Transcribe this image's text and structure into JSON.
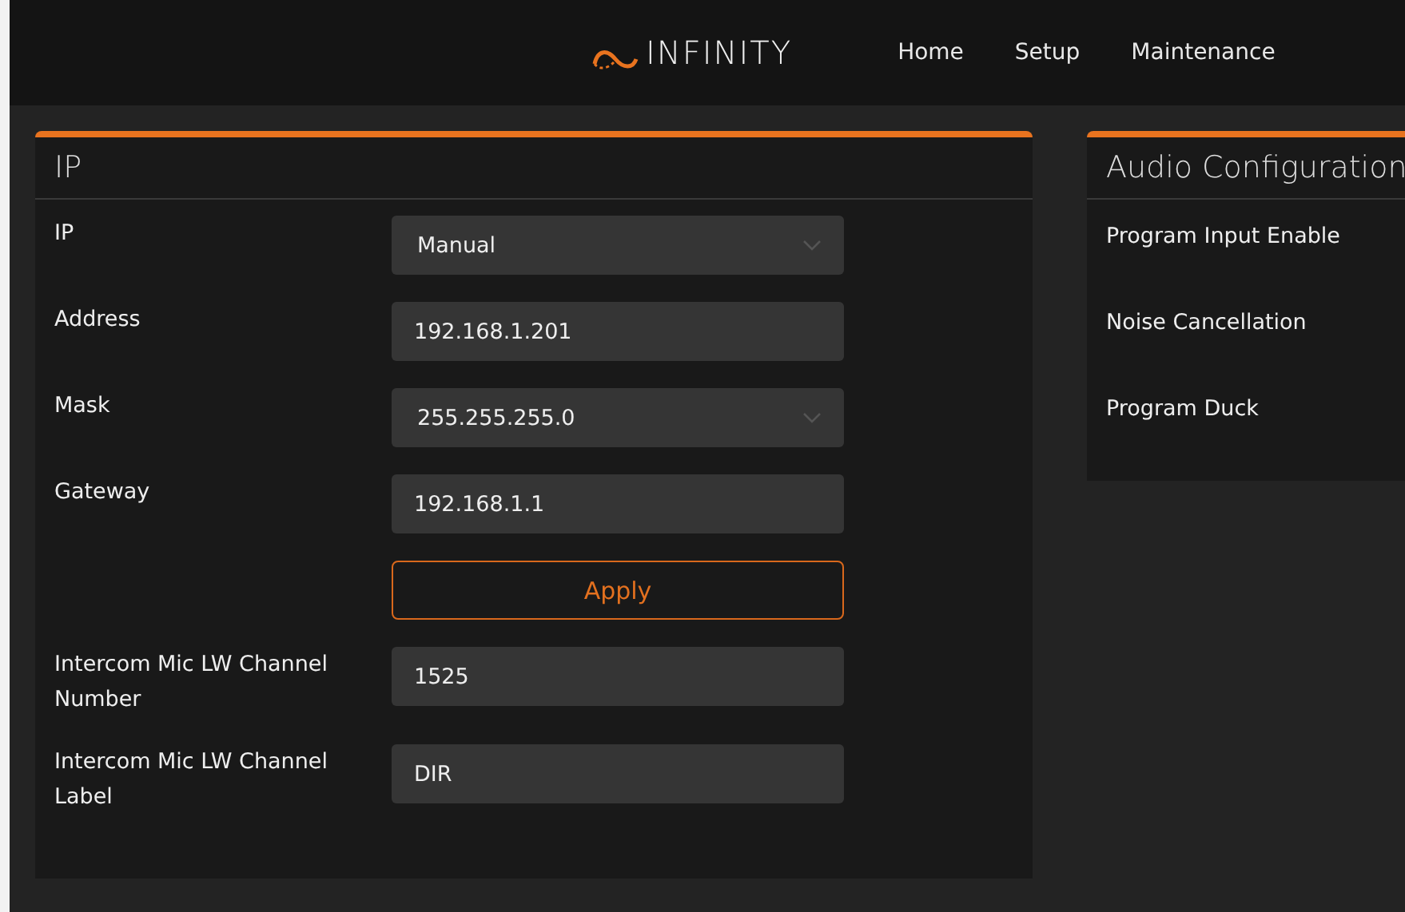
{
  "header": {
    "brand": "INFINITY",
    "nav": [
      {
        "label": "Home"
      },
      {
        "label": "Setup"
      },
      {
        "label": "Maintenance"
      }
    ]
  },
  "ip_panel": {
    "title": "IP",
    "rows": [
      {
        "kind": "select",
        "label": "IP",
        "value": "Manual"
      },
      {
        "kind": "input",
        "label": "Address",
        "value": "192.168.1.201"
      },
      {
        "kind": "select",
        "label": "Mask",
        "value": "255.255.255.0"
      },
      {
        "kind": "input",
        "label": "Gateway",
        "value": "192.168.1.1"
      },
      {
        "kind": "button",
        "label": "Apply"
      },
      {
        "kind": "input",
        "label": "Intercom Mic LW Channel Number",
        "value": "1525"
      },
      {
        "kind": "input",
        "label": "Intercom Mic LW Channel Label",
        "value": "DIR"
      }
    ]
  },
  "audio_panel": {
    "title": "Audio Configuration",
    "rows": [
      "Program Input Enable",
      "Noise Cancellation",
      "Program Duck"
    ]
  }
}
